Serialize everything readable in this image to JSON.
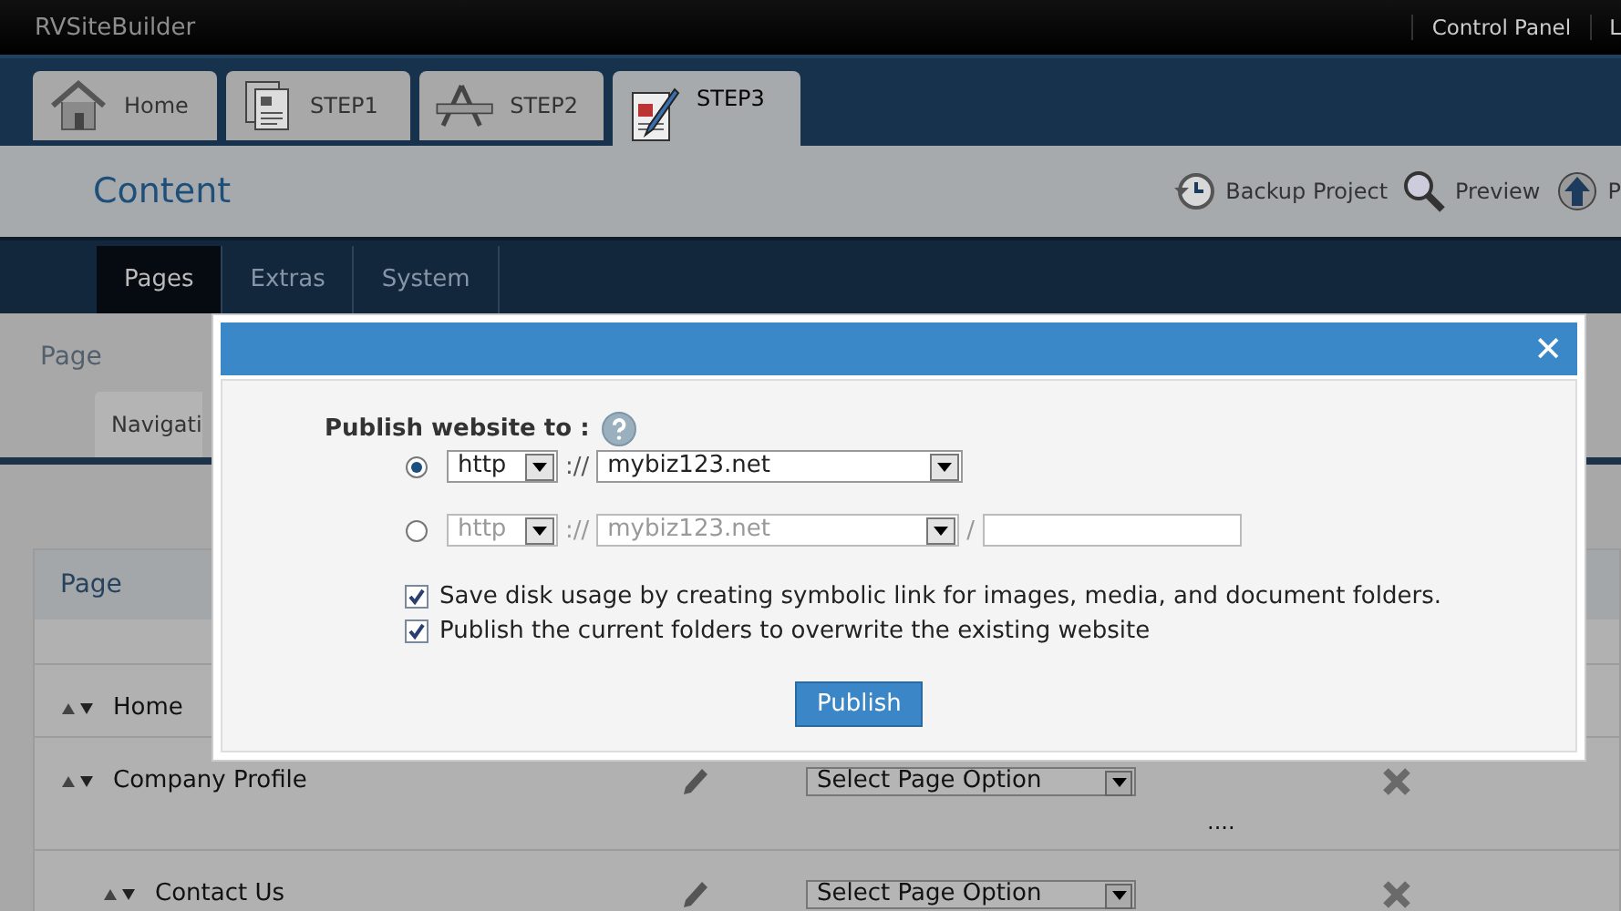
{
  "top_bar": {
    "brand": "RVSiteBuilder",
    "links": [
      "Control Panel",
      "L"
    ]
  },
  "steps": [
    {
      "label": "Home",
      "selected": false
    },
    {
      "label": "STEP1",
      "selected": false
    },
    {
      "label": "STEP2",
      "selected": false
    },
    {
      "label": "STEP3",
      "selected": true
    }
  ],
  "content_bar": {
    "title": "Content",
    "actions": [
      "Backup Project",
      "Preview",
      "P"
    ]
  },
  "sub_nav": [
    {
      "label": "Pages",
      "selected": true
    },
    {
      "label": "Extras",
      "selected": false
    },
    {
      "label": "System",
      "selected": false
    }
  ],
  "page_area": {
    "heading": "Page",
    "tab": "Navigati",
    "table_header": "Page",
    "gap_text": "....",
    "rows": [
      {
        "name": "Home"
      },
      {
        "name": "Company Profile",
        "option": "Select Page Option",
        "children": [
          {
            "name": "Contact Us",
            "option": "Select Page Option"
          }
        ]
      }
    ]
  },
  "dialog": {
    "close": "✕",
    "label": "Publish website to :",
    "targets": [
      {
        "selected": true,
        "disabled": false,
        "protocol": "http",
        "separator": "://",
        "domain": "mybiz123.net"
      },
      {
        "selected": false,
        "disabled": true,
        "protocol": "http",
        "separator": "://",
        "domain": "mybiz123.net",
        "slash": "/"
      }
    ],
    "options": [
      {
        "label": "Save disk usage by creating symbolic link for images, media, and document folders.",
        "checked": true
      },
      {
        "label": "Publish the current folders to overwrite the existing website",
        "checked": true
      }
    ],
    "button": "Publish"
  }
}
